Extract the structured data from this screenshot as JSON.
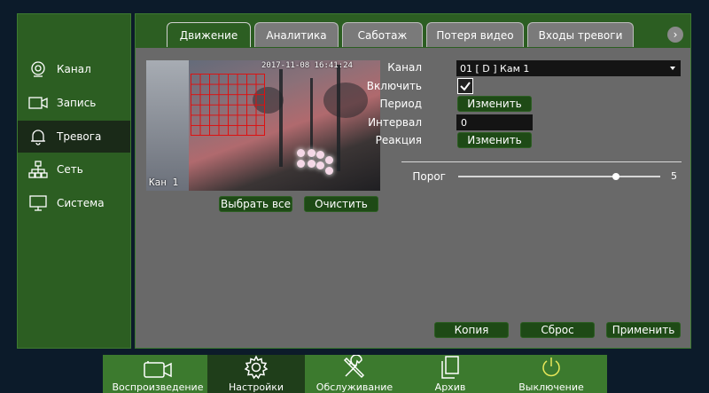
{
  "sidebar": {
    "items": [
      {
        "label": "Канал",
        "icon": "camera-lens-icon"
      },
      {
        "label": "Запись",
        "icon": "video-record-icon"
      },
      {
        "label": "Тревога",
        "icon": "bell-icon"
      },
      {
        "label": "Сеть",
        "icon": "network-icon"
      },
      {
        "label": "Система",
        "icon": "monitor-icon"
      }
    ],
    "active_index": 2
  },
  "tabs": {
    "items": [
      "Движение",
      "Аналитика",
      "Саботаж",
      "Потеря видео",
      "Входы тревоги"
    ],
    "active_index": 0,
    "next_icon": "chevron-right-icon"
  },
  "preview": {
    "timestamp": "2017-11-08 16:41:24",
    "camera_label": "Кан 1"
  },
  "preview_buttons": {
    "select_all": "Выбрать все",
    "clear": "Очистить"
  },
  "form": {
    "channel_label": "Канал",
    "channel_value": "01 [ D ] Кам 1",
    "enable_label": "Включить",
    "enable_checked": true,
    "period_label": "Период",
    "period_button": "Изменить",
    "interval_label": "Интервал",
    "interval_value": "0",
    "reaction_label": "Реакция",
    "reaction_button": "Изменить",
    "threshold_label": "Порог",
    "threshold_value": "5",
    "threshold_fraction": 0.78
  },
  "actions": {
    "copy": "Копия",
    "reset": "Сброс",
    "apply": "Применить"
  },
  "dock": {
    "items": [
      {
        "label": "Воспроизведение",
        "icon": "camera-icon"
      },
      {
        "label": "Настройки",
        "icon": "gear-icon"
      },
      {
        "label": "Обслуживание",
        "icon": "tools-icon"
      },
      {
        "label": "Архив",
        "icon": "documents-icon"
      },
      {
        "label": "Выключение",
        "icon": "power-icon"
      }
    ],
    "active_index": 1
  },
  "colors": {
    "panel_green": "#2c5e22",
    "button_green": "#1e4a16",
    "content_gray": "#696969",
    "grid_red": "#dd1111",
    "power_yellow": "#e8e85a"
  }
}
